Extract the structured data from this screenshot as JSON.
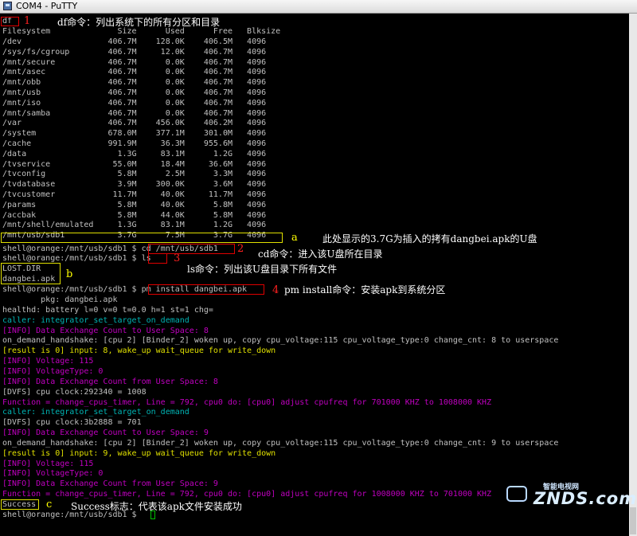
{
  "window": {
    "title": "COM4 - PuTTY"
  },
  "terminal": {
    "df_cmd": "df",
    "header": "Filesystem              Size      Used      Free   Blksize",
    "df_rows": [
      "/dev                  406.7M    128.0K    406.5M   4096",
      "/sys/fs/cgroup        406.7M     12.0K    406.7M   4096",
      "/mnt/secure           406.7M      0.0K    406.7M   4096",
      "/mnt/asec             406.7M      0.0K    406.7M   4096",
      "/mnt/obb              406.7M      0.0K    406.7M   4096",
      "/mnt/usb              406.7M      0.0K    406.7M   4096",
      "/mnt/iso              406.7M      0.0K    406.7M   4096",
      "/mnt/samba            406.7M      0.0K    406.7M   4096",
      "/var                  406.7M    456.0K    406.2M   4096",
      "/system               678.0M    377.1M    301.0M   4096",
      "/cache                991.9M     36.3M    955.6M   4096",
      "/data                   1.3G     83.1M      1.2G   4096",
      "/tvservice             55.0M     18.4M     36.6M   4096",
      "/tvconfig               5.8M      2.5M      3.3M   4096",
      "/tvdatabase             3.9M    300.0K      3.6M   4096",
      "/tvcustomer            11.7M     40.0K     11.7M   4096",
      "/params                 5.8M     40.0K      5.8M   4096",
      "/accbak                 5.8M     44.0K      5.8M   4096",
      "/mnt/shell/emulated     1.3G     83.1M      1.2G   4096",
      "/mnt/usb/sdb1           3.7G      7.5M      3.7G   4096"
    ],
    "prompt": "shell@orange:/mnt/usb/sdb1 $ ",
    "cd_cmd": "cd /mnt/usb/sdb1",
    "ls_cmd": "ls",
    "ls_out": [
      "LOST.DIR",
      "dangbei.apk"
    ],
    "pm_cmd": "pm install dangbei.apk",
    "log_lines": [
      {
        "text": "        pkg: dangbei.apk",
        "color": "plain"
      },
      {
        "text": "healthd: battery l=0 v=0 t=0.0 h=1 st=1 chg=",
        "color": "plain"
      },
      {
        "text": "caller: integrator_set_target_on_demand",
        "color": "cyan"
      },
      {
        "text": "[INFO] Data Exchange Count to User Space: 8",
        "color": "mag"
      },
      {
        "text": "on_demand_handshake: [cpu 2] [Binder_2] woken up, copy cpu_voltage:115 cpu_voltage_type:0 change_cnt: 8 to userspace",
        "color": "plain"
      },
      {
        "text": "[result is 0] input: 8, wake_up wait_queue for write_down",
        "color": "yellow"
      },
      {
        "text": "[INFO] Voltage: 115",
        "color": "mag"
      },
      {
        "text": "[INFO] VoltageType: 0",
        "color": "mag"
      },
      {
        "text": "[INFO] Data Exchange Count from User Space: 8",
        "color": "mag"
      },
      {
        "text": "[DVFS] cpu clock:292340 = 1008",
        "color": "plain"
      },
      {
        "text": "Function = change_cpus_timer, Line = 792, cpu0 do: [cpu0] adjust cpufreq for 701000 KHZ to 1008000 KHZ",
        "color": "mag"
      },
      {
        "text": "caller: integrator_set_target_on_demand",
        "color": "cyan"
      },
      {
        "text": "[DVFS] cpu clock:3b2888 = 701",
        "color": "plain"
      },
      {
        "text": "[INFO] Data Exchange Count to User Space: 9",
        "color": "mag"
      },
      {
        "text": "on_demand_handshake: [cpu 2] [Binder_2] woken up, copy cpu_voltage:115 cpu_voltage_type:0 change_cnt: 9 to userspace",
        "color": "plain"
      },
      {
        "text": "[result is 0] input: 9, wake_up wait_queue for write_down",
        "color": "yellow"
      },
      {
        "text": "[INFO] Voltage: 115",
        "color": "mag"
      },
      {
        "text": "[INFO] VoltageType: 0",
        "color": "mag"
      },
      {
        "text": "[INFO] Data Exchange Count from User Space: 9",
        "color": "mag"
      },
      {
        "text": "Function = change_cpus_timer, Line = 792, cpu0 do: [cpu0] adjust cpufreq for 1008000 KHZ to 701000 KHZ",
        "color": "mag"
      }
    ],
    "success": "Success",
    "final_prompt": "shell@orange:/mnt/usb/sdb1 $ "
  },
  "annotations": {
    "n1": "1",
    "n2": "2",
    "n3": "3",
    "n4": "4",
    "a": "a",
    "b": "b",
    "c": "c",
    "df_note": "df命令：列出系统下的所有分区和目录",
    "a_note": "此处显示的3.7G为插入的拷有dangbei.apk的U盘",
    "cd_note": "cd命令：进入该U盘所在目录",
    "ls_note": "ls命令：列出该U盘目录下所有文件",
    "pm_note": "pm install命令：安装apk到系统分区",
    "success_note": "Success标志：代表该apk文件安装成功"
  },
  "watermark": {
    "small": "智能电视网",
    "big": "ZNDS.com"
  },
  "colors": {
    "cyan": "#00b4b4",
    "magenta": "#c000c0",
    "yellow": "#e0e000",
    "red": "#e00000",
    "text": "#c0c0c0"
  }
}
